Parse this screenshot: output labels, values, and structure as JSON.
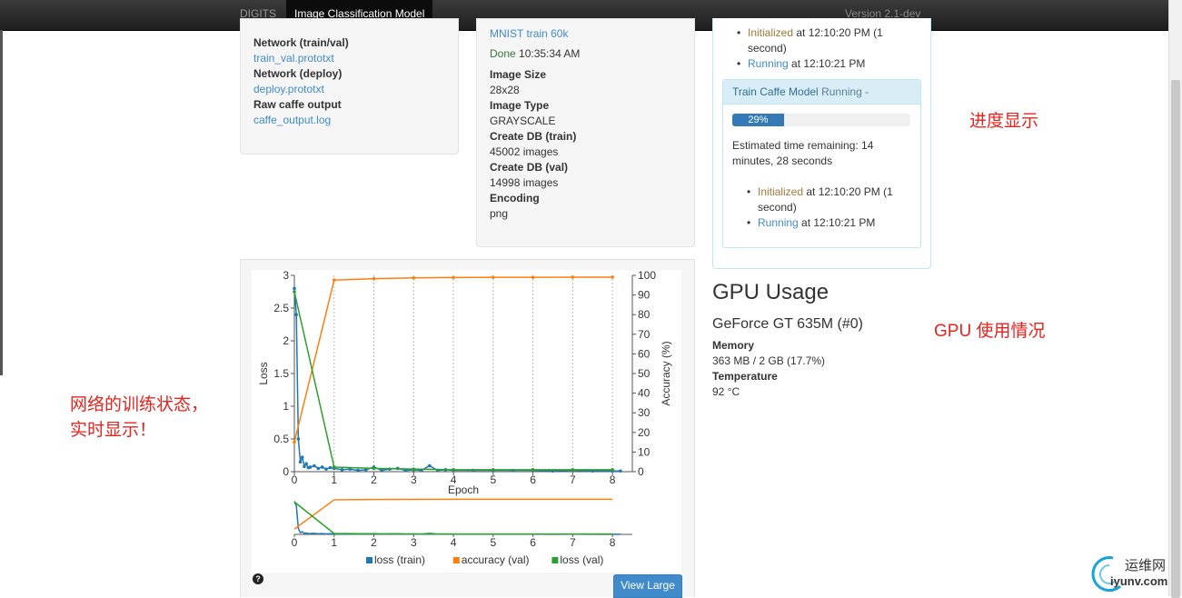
{
  "nav": {
    "brand": "DIGITS",
    "active_tab": "Image Classification Model",
    "version": "Version 2.1-dev"
  },
  "model_files": {
    "network_train_label": "Network (train/val)",
    "network_train_file": "train_val.prototxt",
    "network_deploy_label": "Network (deploy)",
    "network_deploy_file": "deploy.prototxt",
    "raw_output_label": "Raw caffe output",
    "raw_output_file": "caffe_output.log"
  },
  "dataset": {
    "name": "MNIST train 60k",
    "done_label": "Done",
    "done_time": "10:35:34 AM",
    "image_size_label": "Image Size",
    "image_size": "28x28",
    "image_type_label": "Image Type",
    "image_type": "GRAYSCALE",
    "create_train_label": "Create DB (train)",
    "create_train": "45002 images",
    "create_val_label": "Create DB (val)",
    "create_val": "14998 images",
    "encoding_label": "Encoding",
    "encoding": "png"
  },
  "job_status": {
    "top_initialized": "Initialized",
    "top_initialized_rest": " at 12:10:20 PM (1",
    "top_initialized_rest2": "second)",
    "top_running": "Running",
    "top_running_rest": " at 12:10:21 PM",
    "task_title": "Train Caffe Model",
    "task_status": "Running",
    "task_toggle": "-",
    "progress_label": "29%",
    "progress_fraction": 0.29,
    "eta_line1": "Estimated time remaining: 14",
    "eta_line2": "minutes, 28 seconds",
    "initialized": "Initialized",
    "initialized_rest": " at 12:10:20 PM (1",
    "initialized_rest2": "second)",
    "running": "Running",
    "running_rest": " at 12:10:21 PM"
  },
  "gpu": {
    "title": "GPU Usage",
    "name": "GeForce GT 635M (#0)",
    "memory_label": "Memory",
    "memory": "363 MB / 2 GB (17.7%)",
    "temp_label": "Temperature",
    "temp": "92 °C"
  },
  "annotations": {
    "progress": "进度显示",
    "gpu": "GPU 使用情况",
    "training_line1": "网络的训练状态，",
    "training_line2": "实时显示！"
  },
  "buttons": {
    "view_large": "View Large",
    "help": "?"
  },
  "watermark": {
    "line1": "运维网",
    "line2": "iyunv.com"
  },
  "chart_data": {
    "type": "line",
    "xlabel": "Epoch",
    "ylabel": "Loss",
    "y2label": "Accuracy (%)",
    "xlim": [
      0,
      8.5
    ],
    "ylim": [
      0,
      3
    ],
    "y2lim": [
      0,
      100
    ],
    "xticks": [
      "0",
      "1",
      "2",
      "3",
      "4",
      "5",
      "6",
      "7",
      "8"
    ],
    "yticks": [
      "0",
      "0.5",
      "1",
      "1.5",
      "2",
      "2.5",
      "3"
    ],
    "y2ticks": [
      "0",
      "10",
      "20",
      "30",
      "40",
      "50",
      "60",
      "70",
      "80",
      "90",
      "100"
    ],
    "colors": {
      "loss_train": "#1f77b4",
      "accuracy_val": "#ff7f0e",
      "loss_val": "#2ca02c"
    },
    "legend": [
      "loss (train)",
      "accuracy (val)",
      "loss (val)"
    ],
    "legend_position": "bottom",
    "series": [
      {
        "name": "loss (train)",
        "axis": "left",
        "x": [
          0,
          0.05,
          0.1,
          0.15,
          0.2,
          0.25,
          0.3,
          0.35,
          0.4,
          0.5,
          0.6,
          0.7,
          0.8,
          0.9,
          1.0,
          1.2,
          1.4,
          1.6,
          1.8,
          2.0,
          2.2,
          2.4,
          2.6,
          2.8,
          3.0,
          3.2,
          3.4,
          3.6,
          3.8,
          4.0,
          4.5,
          5.0,
          5.5,
          6.0,
          6.5,
          7.0,
          7.5,
          8.0,
          8.2
        ],
        "y": [
          2.8,
          2.4,
          0.5,
          0.15,
          0.22,
          0.08,
          0.12,
          0.06,
          0.07,
          0.09,
          0.05,
          0.07,
          0.04,
          0.06,
          0.05,
          0.03,
          0.04,
          0.02,
          0.03,
          0.07,
          0.02,
          0.04,
          0.05,
          0.02,
          0.03,
          0.02,
          0.09,
          0.02,
          0.03,
          0.02,
          0.02,
          0.02,
          0.02,
          0.02,
          0.01,
          0.02,
          0.01,
          0.01,
          0.01
        ]
      },
      {
        "name": "accuracy (val)",
        "axis": "right",
        "x": [
          0,
          1,
          2,
          3,
          4,
          5,
          6,
          7,
          8
        ],
        "y": [
          15,
          97.6,
          98.3,
          98.7,
          98.9,
          99.0,
          99.0,
          99.1,
          99.1
        ]
      },
      {
        "name": "loss (val)",
        "axis": "left",
        "x": [
          0,
          1,
          2,
          3,
          4,
          5,
          6,
          7,
          8
        ],
        "y": [
          2.75,
          0.07,
          0.05,
          0.04,
          0.03,
          0.03,
          0.03,
          0.03,
          0.03
        ]
      }
    ]
  }
}
